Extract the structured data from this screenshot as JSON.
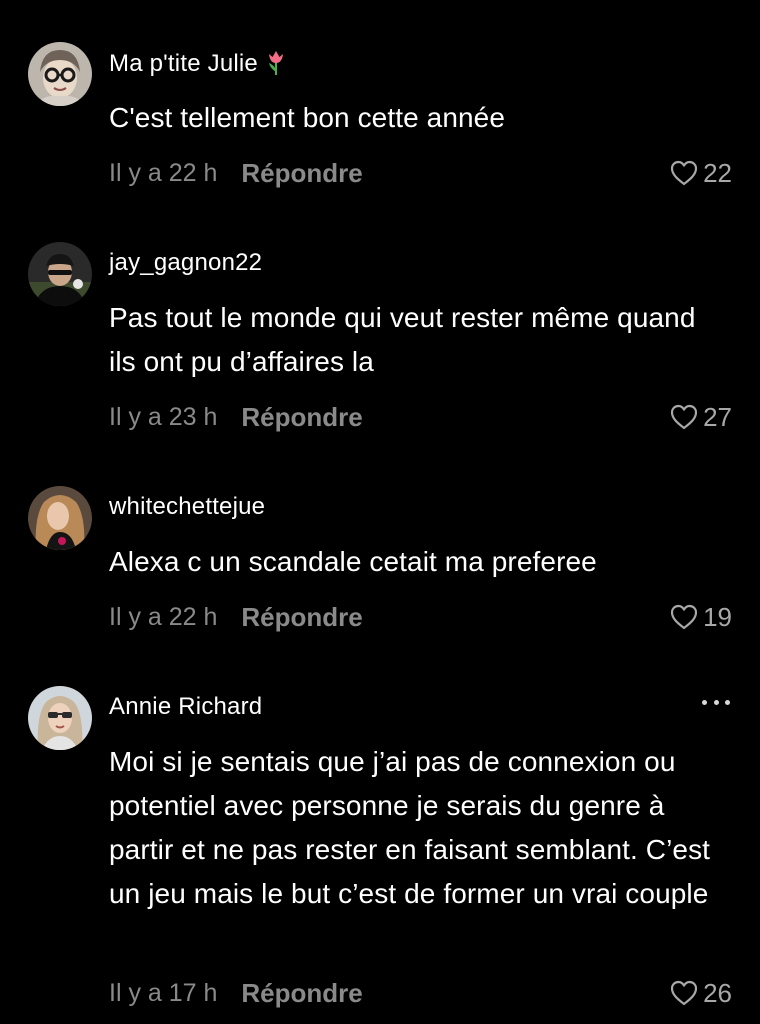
{
  "comments": [
    {
      "username": "Ma p'tite Julie",
      "emoji_icon": "tulip-icon",
      "text": "C'est tellement bon cette année",
      "time": "Il y a 22 h",
      "reply_label": "Répondre",
      "likes": "22",
      "avatar_icon": "avatar-woman-glasses"
    },
    {
      "username": "jay_gagnon22",
      "text": "Pas tout le monde qui veut rester même quand ils ont pu d’affaires la",
      "time": "Il y a 23 h",
      "reply_label": "Répondre",
      "likes": "27",
      "avatar_icon": "avatar-man-cap"
    },
    {
      "username": "whitechettejue",
      "text": "Alexa c un scandale cetait ma preferee",
      "time": "Il y a 22 h",
      "reply_label": "Répondre",
      "likes": "19",
      "avatar_icon": "avatar-woman-curly-hair"
    },
    {
      "username": "Annie Richard",
      "text": "Moi si je sentais que j’ai pas de connexion ou potentiel avec personne je serais du genre à partir et ne pas rester en faisant semblant. C’est un jeu mais le but c’est de former un vrai couple",
      "time": "Il y a 17 h",
      "reply_label": "Répondre",
      "likes": "26",
      "avatar_icon": "avatar-woman-sunglasses",
      "more_icon": "more-options-icon"
    }
  ],
  "colors": {
    "background": "#000000",
    "text": "#ffffff",
    "secondary": "#8a8a8a"
  }
}
